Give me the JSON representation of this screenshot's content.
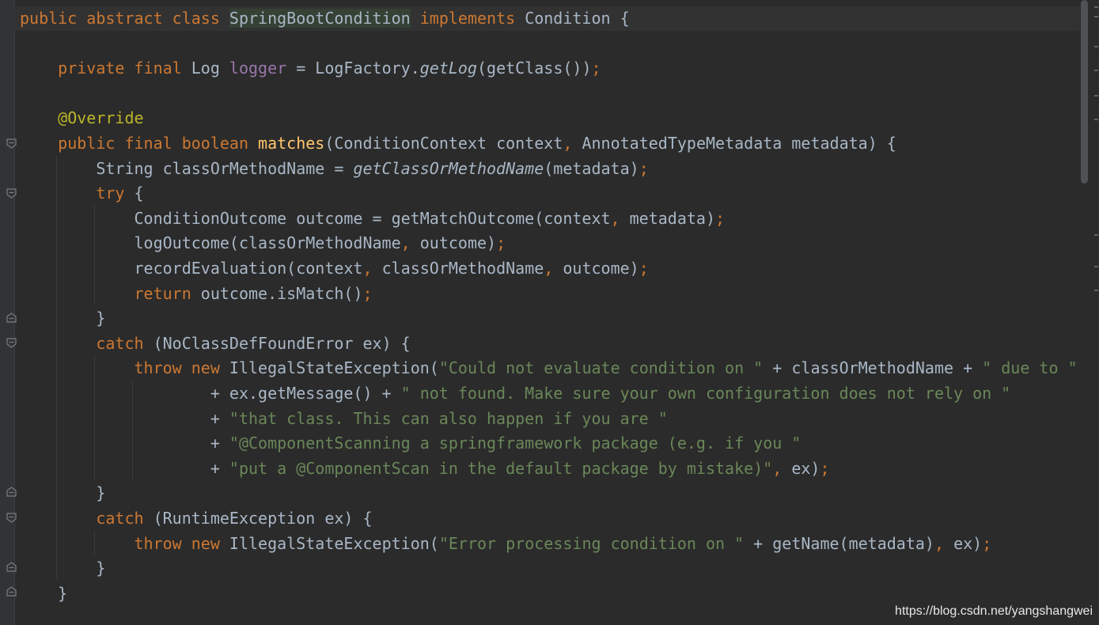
{
  "editor": {
    "language": "Java",
    "theme": "Darcula",
    "lines": [
      [
        [
          "public abstract class ",
          "kw"
        ],
        [
          "SpringBootCondition",
          "cls-hl"
        ],
        [
          " ",
          "cls"
        ],
        [
          "implements ",
          "kw"
        ],
        [
          "Condition {",
          "cls"
        ]
      ],
      [],
      [
        [
          "    ",
          "cls"
        ],
        [
          "private final ",
          "kw"
        ],
        [
          "Log ",
          "cls"
        ],
        [
          "logger",
          "fld"
        ],
        [
          " = LogFactory.",
          "cls"
        ],
        [
          "getLog",
          "ital"
        ],
        [
          "(getClass())",
          "cls"
        ],
        [
          ";",
          "punct"
        ]
      ],
      [],
      [
        [
          "    ",
          "cls"
        ],
        [
          "@Override",
          "ann"
        ]
      ],
      [
        [
          "    ",
          "cls"
        ],
        [
          "public final boolean ",
          "kw"
        ],
        [
          "matches",
          "mth"
        ],
        [
          "(ConditionContext context",
          "cls"
        ],
        [
          ", ",
          "punct"
        ],
        [
          "AnnotatedTypeMetadata metadata) {",
          "cls"
        ]
      ],
      [
        [
          "        String classOrMethodName = ",
          "cls"
        ],
        [
          "getClassOrMethodName",
          "ital"
        ],
        [
          "(metadata)",
          "cls"
        ],
        [
          ";",
          "punct"
        ]
      ],
      [
        [
          "        ",
          "cls"
        ],
        [
          "try ",
          "kw"
        ],
        [
          "{",
          "cls"
        ]
      ],
      [
        [
          "            ConditionOutcome outcome = getMatchOutcome(context",
          "cls"
        ],
        [
          ", ",
          "punct"
        ],
        [
          "metadata)",
          "cls"
        ],
        [
          ";",
          "punct"
        ]
      ],
      [
        [
          "            logOutcome(classOrMethodName",
          "cls"
        ],
        [
          ", ",
          "punct"
        ],
        [
          "outcome)",
          "cls"
        ],
        [
          ";",
          "punct"
        ]
      ],
      [
        [
          "            recordEvaluation(context",
          "cls"
        ],
        [
          ", ",
          "punct"
        ],
        [
          "classOrMethodName",
          "cls"
        ],
        [
          ", ",
          "punct"
        ],
        [
          "outcome)",
          "cls"
        ],
        [
          ";",
          "punct"
        ]
      ],
      [
        [
          "            ",
          "cls"
        ],
        [
          "return ",
          "kw"
        ],
        [
          "outcome.isMatch()",
          "cls"
        ],
        [
          ";",
          "punct"
        ]
      ],
      [
        [
          "        }",
          "cls"
        ]
      ],
      [
        [
          "        ",
          "cls"
        ],
        [
          "catch ",
          "kw"
        ],
        [
          "(NoClassDefFoundError ex) {",
          "cls"
        ]
      ],
      [
        [
          "            ",
          "cls"
        ],
        [
          "throw new ",
          "kw"
        ],
        [
          "IllegalStateException(",
          "cls"
        ],
        [
          "\"Could not evaluate condition on \"",
          "str"
        ],
        [
          " + classOrMethodName + ",
          "cls"
        ],
        [
          "\" due to \"",
          "str"
        ]
      ],
      [
        [
          "                    + ex.getMessage() + ",
          "cls"
        ],
        [
          "\" not found. Make sure your own configuration does not rely on \"",
          "str"
        ]
      ],
      [
        [
          "                    + ",
          "cls"
        ],
        [
          "\"that class. This can also happen if you are \"",
          "str"
        ]
      ],
      [
        [
          "                    + ",
          "cls"
        ],
        [
          "\"@ComponentScanning a springframework package (e.g. if you \"",
          "str"
        ]
      ],
      [
        [
          "                    + ",
          "cls"
        ],
        [
          "\"put a @ComponentScan in the default package by mistake)\"",
          "str"
        ],
        [
          ", ",
          "punct"
        ],
        [
          "ex)",
          "cls"
        ],
        [
          ";",
          "punct"
        ]
      ],
      [
        [
          "        }",
          "cls"
        ]
      ],
      [
        [
          "        ",
          "cls"
        ],
        [
          "catch ",
          "kw"
        ],
        [
          "(RuntimeException ex) {",
          "cls"
        ]
      ],
      [
        [
          "            ",
          "cls"
        ],
        [
          "throw new ",
          "kw"
        ],
        [
          "IllegalStateException(",
          "cls"
        ],
        [
          "\"Error processing condition on \"",
          "str"
        ],
        [
          " + getName(metadata)",
          "cls"
        ],
        [
          ", ",
          "punct"
        ],
        [
          "ex)",
          "cls"
        ],
        [
          ";",
          "punct"
        ]
      ],
      [
        [
          "        }",
          "cls"
        ]
      ],
      [
        [
          "    }",
          "cls"
        ]
      ]
    ]
  },
  "watermark": "https://blog.csdn.net/yangshangwei",
  "colors": {
    "background": "#2b2b2b",
    "keyword": "#cc7832",
    "text": "#a9b7c6",
    "field": "#9876aa",
    "annotation": "#bbb529",
    "method_decl": "#ffc66d",
    "string": "#6a8759"
  },
  "icons": [
    "fold-start-icon",
    "fold-end-icon"
  ]
}
